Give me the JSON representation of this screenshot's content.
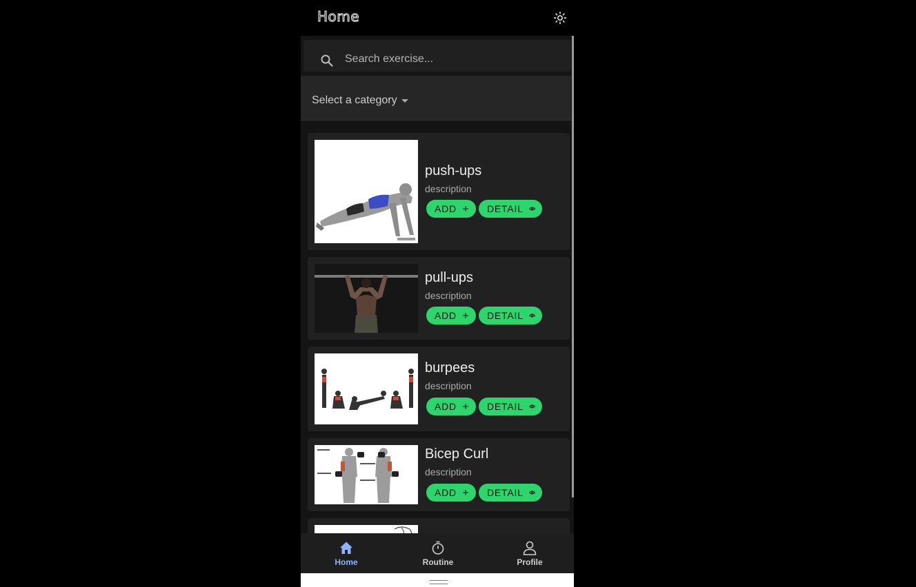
{
  "app": {
    "title": "Home"
  },
  "search": {
    "placeholder": "Search exercise..."
  },
  "category": {
    "label": "Select a category"
  },
  "buttons": {
    "add_label": "ADD",
    "detail_label": "DETAIL"
  },
  "exercises": [
    {
      "name": "push-ups",
      "description": "description"
    },
    {
      "name": "pull-ups",
      "description": "description"
    },
    {
      "name": "burpees",
      "description": "description"
    },
    {
      "name": "Bicep Curl",
      "description": "description"
    }
  ],
  "nav": {
    "items": [
      {
        "label": "Home",
        "icon": "home-icon",
        "active": true
      },
      {
        "label": "Routine",
        "icon": "stopwatch-icon",
        "active": false
      },
      {
        "label": "Profile",
        "icon": "person-icon",
        "active": false
      }
    ]
  },
  "colors": {
    "accent": "#2ed46c",
    "nav_active": "#8fb3ff",
    "surface": "#212121",
    "background": "#141414"
  }
}
